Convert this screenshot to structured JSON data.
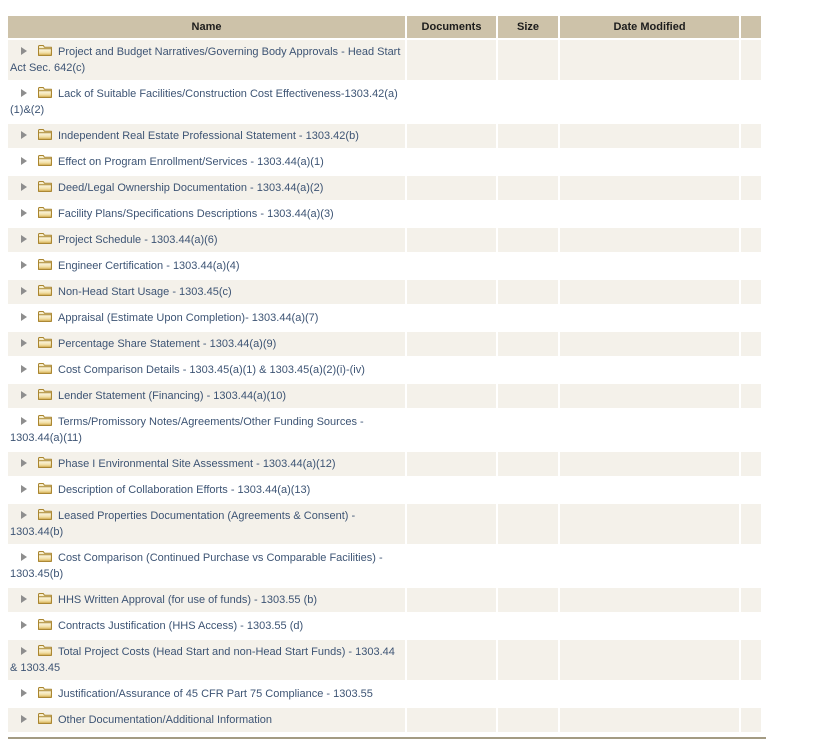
{
  "table": {
    "columns": [
      {
        "label": "Name"
      },
      {
        "label": "Documents"
      },
      {
        "label": "Size"
      },
      {
        "label": "Date Modified"
      },
      {
        "label": ""
      }
    ],
    "rows": [
      {
        "name": "Project and Budget Narratives/Governing Body Approvals - Head Start Act Sec. 642(c)"
      },
      {
        "name": "Lack of Suitable Facilities/Construction Cost Effectiveness-1303.42(a)(1)&(2)"
      },
      {
        "name": "Independent Real Estate Professional Statement - 1303.42(b)"
      },
      {
        "name": "Effect on Program Enrollment/Services - 1303.44(a)(1)"
      },
      {
        "name": "Deed/Legal Ownership Documentation - 1303.44(a)(2)"
      },
      {
        "name": "Facility Plans/Specifications Descriptions - 1303.44(a)(3)"
      },
      {
        "name": "Project Schedule - 1303.44(a)(6)"
      },
      {
        "name": "Engineer Certification - 1303.44(a)(4)"
      },
      {
        "name": "Non-Head Start Usage - 1303.45(c)"
      },
      {
        "name": "Appraisal (Estimate Upon Completion)- 1303.44(a)(7)"
      },
      {
        "name": "Percentage Share Statement - 1303.44(a)(9)"
      },
      {
        "name": "Cost Comparison Details - 1303.45(a)(1) & 1303.45(a)(2)(i)-(iv)"
      },
      {
        "name": "Lender Statement (Financing) - 1303.44(a)(10)"
      },
      {
        "name": "Terms/Promissory Notes/Agreements/Other Funding Sources - 1303.44(a)(11)"
      },
      {
        "name": "Phase I Environmental Site Assessment - 1303.44(a)(12)"
      },
      {
        "name": "Description of Collaboration Efforts - 1303.44(a)(13)"
      },
      {
        "name": "Leased Properties Documentation (Agreements & Consent) - 1303.44(b)"
      },
      {
        "name": "Cost Comparison (Continued Purchase vs Comparable Facilities) - 1303.45(b)"
      },
      {
        "name": "HHS Written Approval (for use of funds) - 1303.55 (b)"
      },
      {
        "name": "Contracts Justification (HHS Access) - 1303.55 (d)"
      },
      {
        "name": "Total Project Costs (Head Start and non-Head Start Funds) - 1303.44 & 1303.45"
      },
      {
        "name": "Justification/Assurance of 45 CFR Part 75 Compliance - 1303.55"
      },
      {
        "name": "Other Documentation/Additional Information"
      }
    ]
  },
  "icons": {
    "expander": "collapsed-right-triangle",
    "folder": "closed-folder"
  },
  "colors": {
    "header_bg": "#cdc2a9",
    "row_alt_bg": "#f4f1ea",
    "row_bg": "#ffffff",
    "folder_text": "#3d5474",
    "header_text": "#1c1c1c",
    "bottom_rule": "#a39b83",
    "folder_icon_stroke": "#a9852f",
    "expander_gray": "#8e8e8e"
  }
}
